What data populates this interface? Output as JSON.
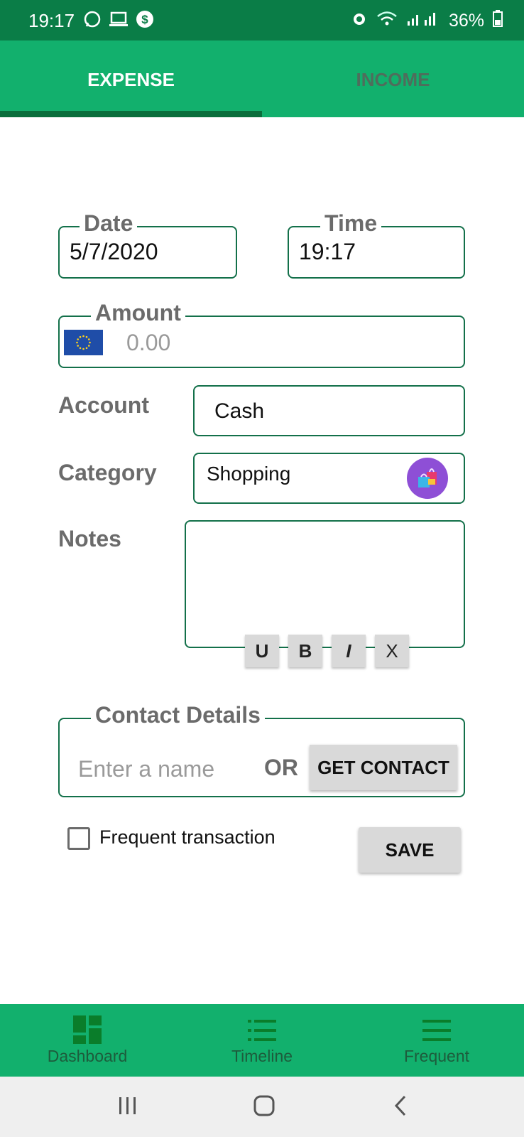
{
  "status_bar": {
    "time": "19:17",
    "battery": "36%",
    "icons": [
      "whatsapp-icon",
      "laptop-icon",
      "dollar-icon",
      "alarm-icon",
      "wifi-icon",
      "signal-icon",
      "battery-icon"
    ]
  },
  "tabs": [
    {
      "label": "EXPENSE",
      "active": true
    },
    {
      "label": "INCOME",
      "active": false
    }
  ],
  "form": {
    "date_label": "Date",
    "date_value": "5/7/2020",
    "time_label": "Time",
    "time_value": "19:17",
    "amount_label": "Amount",
    "amount_placeholder": "0.00",
    "currency_icon": "eu-flag-icon",
    "account_label": "Account",
    "account_value": "Cash",
    "category_label": "Category",
    "category_value": "Shopping",
    "category_icon": "shopping-bags-icon",
    "notes_label": "Notes",
    "notes_value": "",
    "format_buttons": [
      "U",
      "B",
      "I",
      "X"
    ]
  },
  "contact": {
    "label": "Contact Details",
    "name_placeholder": "Enter a name",
    "or_text": "OR",
    "get_contact_label": "GET CONTACT"
  },
  "frequent": {
    "label": "Frequent transaction",
    "checked": false
  },
  "save_label": "SAVE",
  "bottom_nav": [
    {
      "label": "Dashboard",
      "icon": "dashboard-icon"
    },
    {
      "label": "Timeline",
      "icon": "list-icon"
    },
    {
      "label": "Frequent",
      "icon": "menu-icon"
    }
  ],
  "colors": {
    "primary": "#12b06d",
    "primary_dark": "#0a7d47",
    "border": "#13704a",
    "label_gray": "#6b6b6b"
  }
}
